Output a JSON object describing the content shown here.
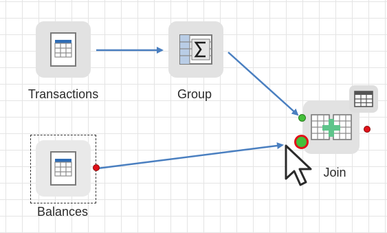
{
  "canvas": {
    "nodes": [
      {
        "id": "transactions",
        "label": "Transactions",
        "icon": "table-document-icon",
        "selected": false
      },
      {
        "id": "group",
        "label": "Group",
        "icon": "sigma-table-icon",
        "selected": false
      },
      {
        "id": "balances",
        "label": "Balances",
        "icon": "table-document-icon",
        "selected": true
      },
      {
        "id": "join",
        "label": "Join",
        "icon": "join-tables-icon",
        "selected": false
      }
    ],
    "connections": [
      {
        "from": "Transactions",
        "to": "Group"
      },
      {
        "from": "Group",
        "to": "Join"
      },
      {
        "from": "Balances",
        "to": "Join"
      }
    ]
  },
  "colors": {
    "link": "#4a7fc0",
    "port_green": "#44c03a",
    "port_red": "#e0121a",
    "tile": "#e2e2e2",
    "table_header": "#2f6db6"
  }
}
